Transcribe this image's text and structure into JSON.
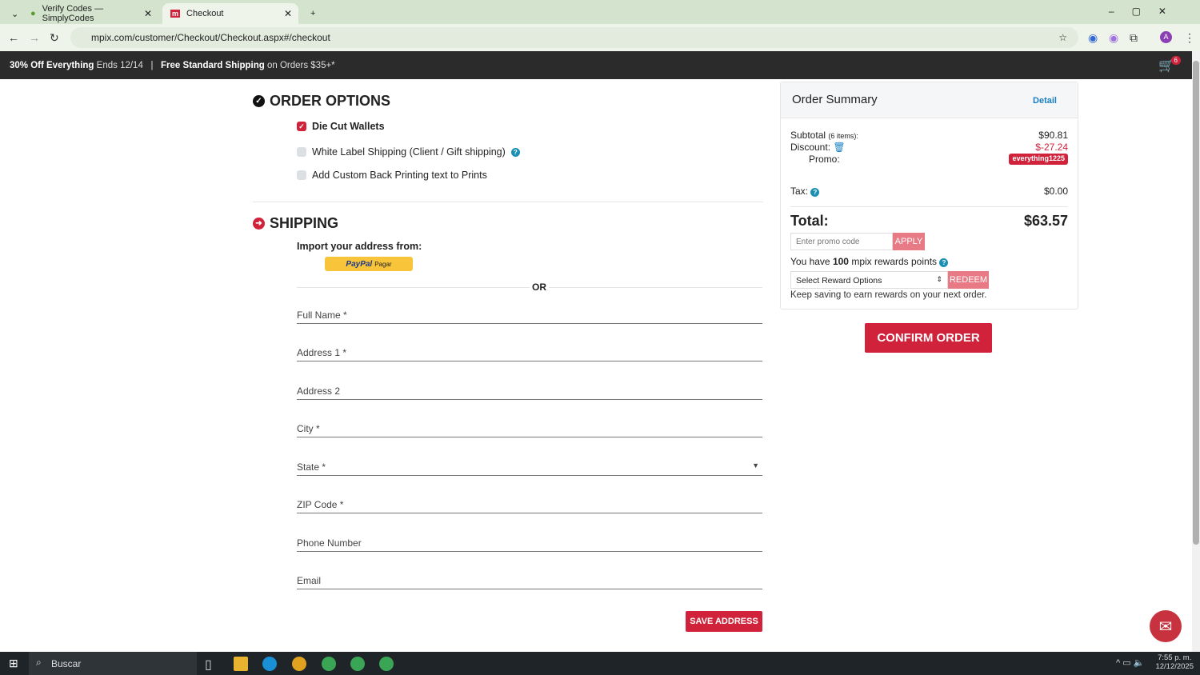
{
  "browser": {
    "tabs": [
      {
        "label": "Verify Codes — SimplyCodes"
      },
      {
        "label": "Checkout"
      }
    ],
    "url": "mpix.com/customer/Checkout/Checkout.aspx#/checkout"
  },
  "banner": {
    "offer_bold": "30% Off Everything",
    "offer_rest": "Ends 12/14",
    "sep": "|",
    "ship_bold": "Free Standard Shipping",
    "ship_rest": "on Orders $35+*",
    "cart_count": "6"
  },
  "order_options": {
    "title": "ORDER OPTIONS",
    "items": [
      {
        "label": "Die Cut Wallets",
        "checked": true
      },
      {
        "label": "White Label Shipping (Client / Gift shipping)",
        "checked": false
      },
      {
        "label": "Add Custom Back Printing text to Prints",
        "checked": false
      }
    ]
  },
  "shipping": {
    "title": "SHIPPING",
    "import_label": "Import your address from:",
    "paypal": "PayPal",
    "paypal_pagar": "Pagar",
    "or": "OR",
    "fields": [
      "Full Name *",
      "Address 1 *",
      "Address 2",
      "City *",
      "State *",
      "ZIP Code *",
      "Phone Number",
      "Email"
    ],
    "save": "SAVE ADDRESS"
  },
  "summary": {
    "title": "Order Summary",
    "detail": "Detail",
    "subtotal_label": "Subtotal",
    "items": "(6 items):",
    "subtotal": "$90.81",
    "discount_label": "Discount:",
    "discount": "$-27.24",
    "promo_label": "Promo:",
    "promo_code": "everything1225",
    "tax_label": "Tax:",
    "tax": "$0.00",
    "total_label": "Total:",
    "total": "$63.57",
    "promo_placeholder": "Enter promo code",
    "apply": "APPLY",
    "rewards_pre": "You have",
    "rewards_points": "100",
    "rewards_post": "mpix rewards points",
    "reward_select": "Select Reward Options",
    "redeem": "REDEEM",
    "keep_saving": "Keep saving to earn rewards on your next order.",
    "confirm": "CONFIRM ORDER"
  },
  "taskbar": {
    "search": "Buscar",
    "time": "7:55 p. m.",
    "date": "12/12/2025"
  }
}
